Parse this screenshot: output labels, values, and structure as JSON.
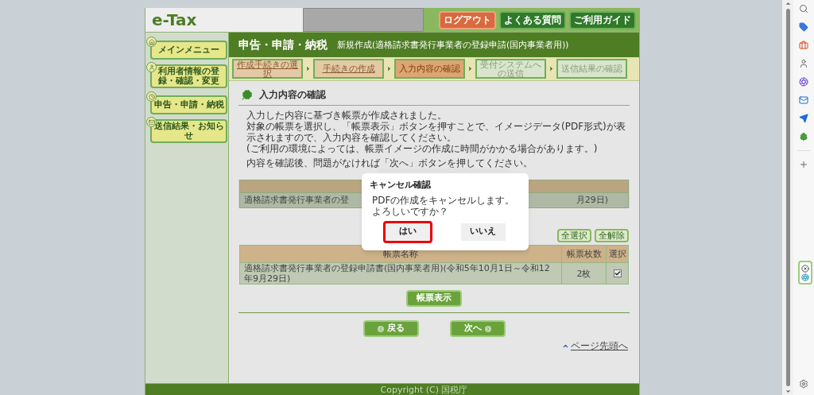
{
  "header": {
    "logo": "e-Tax",
    "buttons": [
      {
        "label": "ログアウト",
        "kind": "logout"
      },
      {
        "label": "よくある質問",
        "kind": "nav"
      },
      {
        "label": "ご利用ガイド",
        "kind": "nav"
      }
    ]
  },
  "sidebar": {
    "items": [
      {
        "label": "メインメニュー"
      },
      {
        "label": "利用者情報の登録・確認・変更"
      },
      {
        "label": "申告・申請・納税"
      },
      {
        "label": "送信結果・お知らせ"
      }
    ]
  },
  "title_bar": {
    "title": "申告・申請・納税",
    "subtitle": "新規作成(適格請求書発行事業者の登録申請(国内事業者用))"
  },
  "steps": [
    {
      "label": "作成手続きの選択",
      "kind": "done"
    },
    {
      "label": "手続きの作成",
      "kind": "done"
    },
    {
      "label": "入力内容の確認",
      "kind": "current"
    },
    {
      "label": "受付システムへの送信",
      "kind": "pending"
    },
    {
      "label": "送信結果の確認",
      "kind": "pending"
    }
  ],
  "heading": "入力内容の確認",
  "intro": [
    "入力した内容に基づき帳票が作成されました。",
    "対象の帳票を選択し、「帳票表示」ボタンを押すことで、イメージデータ(PDF形式)が表示されますので、入力内容を確認してください。",
    "(ご利用の環境によっては、帳票イメージの作成に時間がかかる場合があります。)"
  ],
  "instruction": "内容を確認後、問題がなければ「次へ」ボタンを押してください。",
  "upper_table": {
    "row_left": "適格請求書発行事業者の登",
    "row_right": "月29日)"
  },
  "select_buttons": [
    "全選択",
    "全解除"
  ],
  "form_table": {
    "columns": [
      "帳票名称",
      "帳票枚数",
      "選択"
    ],
    "rows": [
      {
        "name": "適格請求書発行事業者の登録申請書(国内事業者用)(令和5年10月1日～令和12年9月29日)",
        "count": "2枚",
        "checked": true
      }
    ]
  },
  "view_button": "帳票表示",
  "back_button": "戻る",
  "next_button": "次へ",
  "top_link": "ページ先頭へ",
  "footer": "Copyright (C) 国税庁",
  "dialog": {
    "title": "キャンセル確認",
    "message": "PDFの作成をキャンセルします。よろしいですか？",
    "buttons": [
      {
        "label": "はい",
        "highlighted": true
      },
      {
        "label": "いいえ",
        "highlighted": false
      }
    ]
  }
}
